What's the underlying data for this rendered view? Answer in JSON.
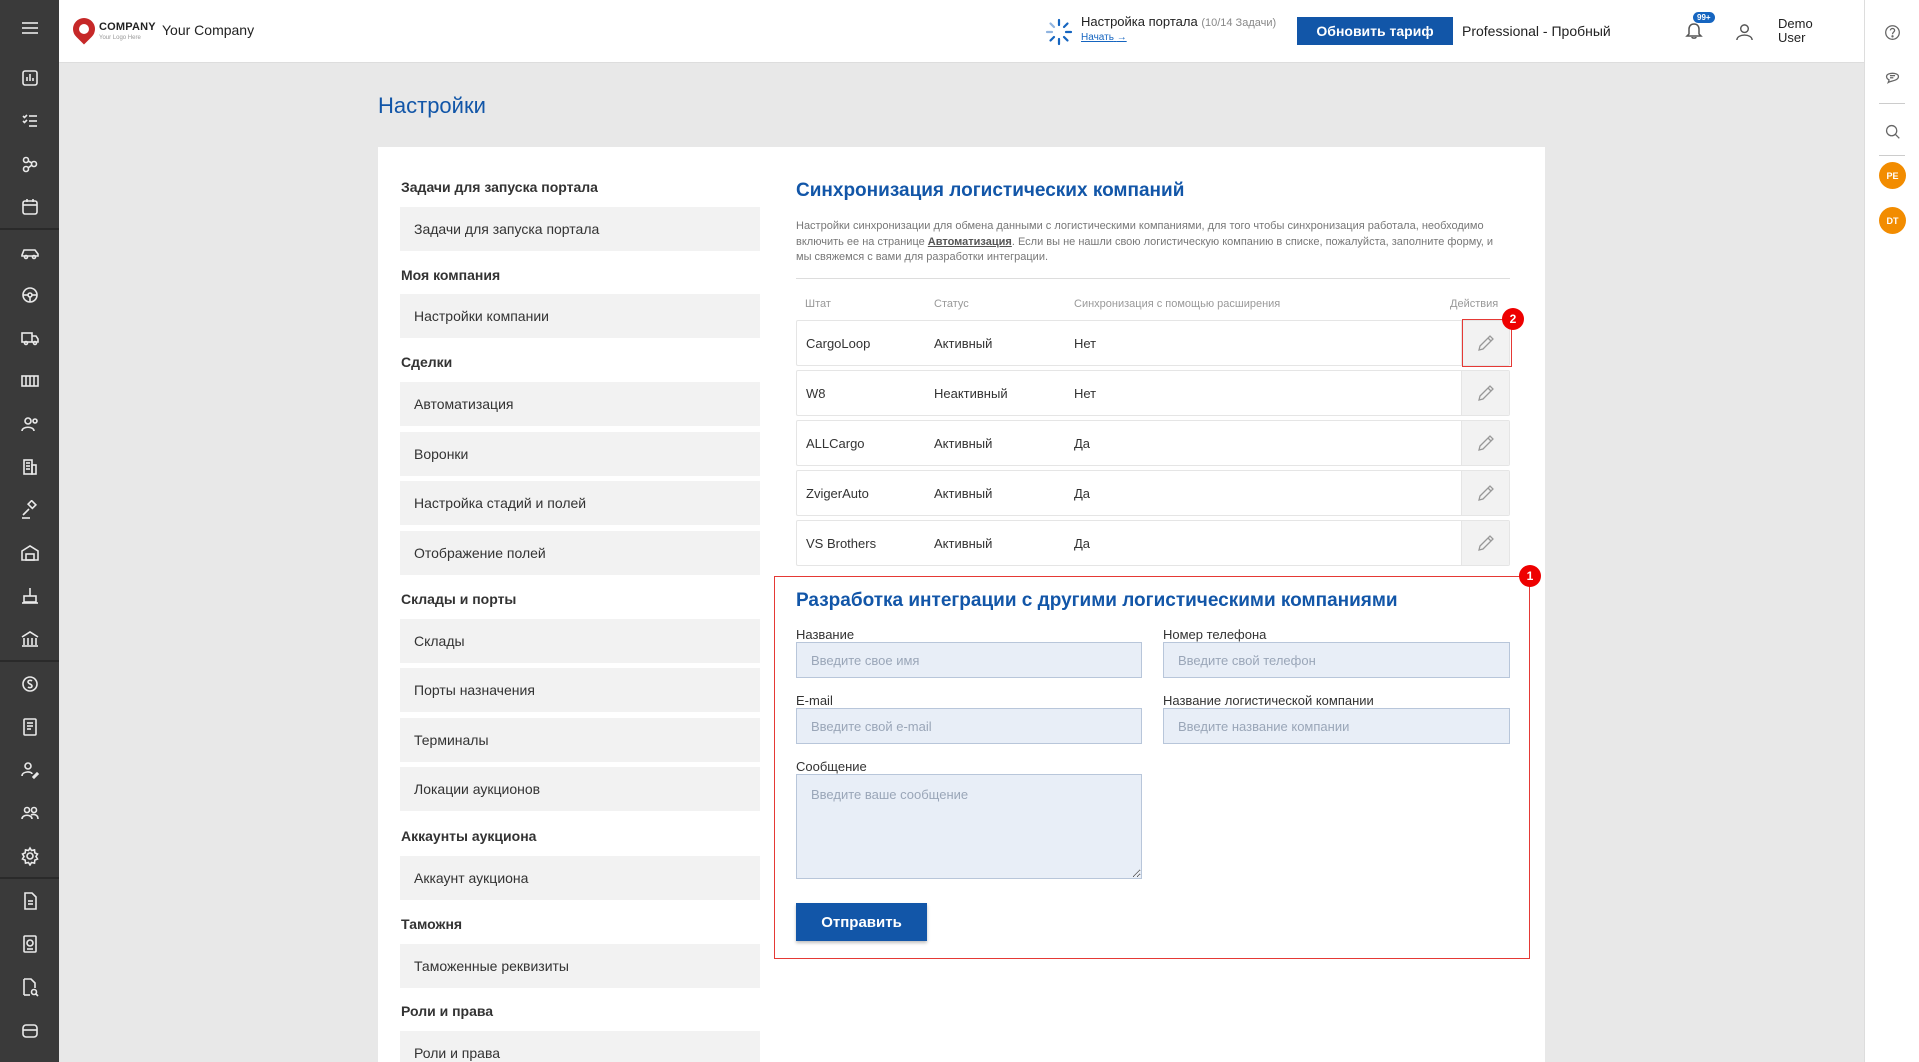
{
  "header": {
    "logo_brand": "COMPANY",
    "logo_tagline": "Your Logo Here",
    "company_name": "Your Company",
    "setup_title": "Настройка портала",
    "setup_progress": "(10/14 Задачи)",
    "setup_link": "Начать",
    "upgrade_label": "Обновить тариф",
    "plan": "Professional - Пробный",
    "notifications_badge": "99+",
    "user_name": "Demo User"
  },
  "rightbar": {
    "avatars": [
      "PE",
      "DT"
    ]
  },
  "page": {
    "title": "Настройки"
  },
  "menu": {
    "sections": [
      {
        "title": "Задачи для запуска портала",
        "items": [
          "Задачи для запуска портала"
        ]
      },
      {
        "title": "Моя компания",
        "items": [
          "Настройки компании"
        ]
      },
      {
        "title": "Сделки",
        "items": [
          "Автоматизация",
          "Воронки",
          "Настройка стадий и полей",
          "Отображение полей"
        ]
      },
      {
        "title": "Склады и порты",
        "items": [
          "Склады",
          "Порты назначения",
          "Терминалы",
          "Локации аукционов"
        ]
      },
      {
        "title": "Аккаунты аукциона",
        "items": [
          "Аккаунт аукциона"
        ]
      },
      {
        "title": "Таможня",
        "items": [
          "Таможенные реквизиты"
        ]
      },
      {
        "title": "Роли и права",
        "items": [
          "Роли и права"
        ]
      }
    ]
  },
  "sync": {
    "title": "Синхронизация логистических компаний",
    "desc_part1": "Настройки синхронизации для обмена данными с логистическими компаниями, для того чтобы синхронизация работала, необходимо включить ее на странице",
    "desc_link": "Автоматизация",
    "desc_part2": ". Если вы не нашли свою логистическую компанию в списке, пожалуйста, заполните форму, и мы свяжемся с вами для разработки интеграции.",
    "columns": [
      "Штат",
      "Статус",
      "Синхронизация с помощью расширения",
      "Действия"
    ],
    "rows": [
      {
        "name": "CargoLoop",
        "status": "Активный",
        "sync": "Нет"
      },
      {
        "name": "W8",
        "status": "Неактивный",
        "sync": "Нет"
      },
      {
        "name": "ALLCargo",
        "status": "Активный",
        "sync": "Да"
      },
      {
        "name": "ZvigerAuto",
        "status": "Активный",
        "sync": "Да"
      },
      {
        "name": "VS Brothers",
        "status": "Активный",
        "sync": "Да"
      }
    ]
  },
  "integration": {
    "title": "Разработка интеграции с другими логистическими компаниями",
    "name_label": "Название",
    "name_placeholder": "Введите свое имя",
    "phone_label": "Номер телефона",
    "phone_placeholder": "Введите свой телефон",
    "email_label": "E-mail",
    "email_placeholder": "Введите свой e-mail",
    "company_label": "Название логистической компании",
    "company_placeholder": "Введите название компании",
    "message_label": "Сообщение",
    "message_placeholder": "Введите ваше сообщение",
    "submit_label": "Отправить"
  },
  "annotations": {
    "marker1": "1",
    "marker2": "2"
  },
  "colors": {
    "brand_blue": "#1256a8",
    "sidebar_bg": "#3a3a3a",
    "annotation_red": "#e53935",
    "avatar_orange": "#f28c00"
  }
}
